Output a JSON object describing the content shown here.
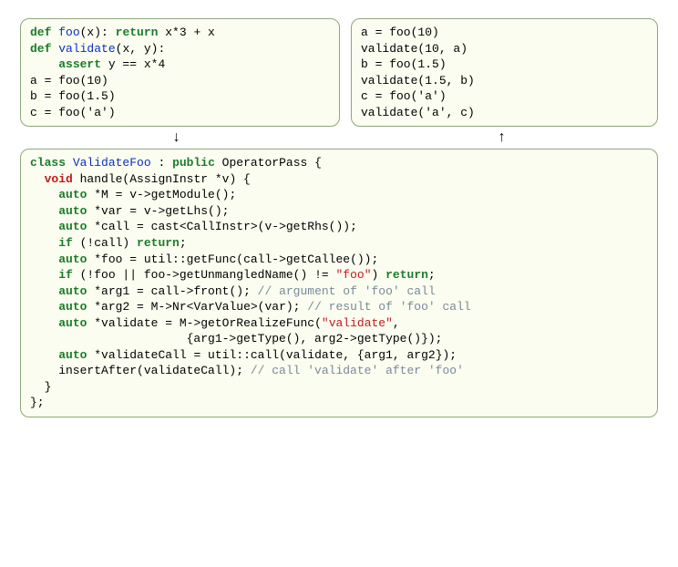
{
  "topLeft": {
    "l1": {
      "def": "def",
      "foo": "foo",
      "rest": "(x): ",
      "ret": "return",
      "expr": " x*3 + x"
    },
    "l2": {
      "def": "def",
      "val": "validate",
      "rest": "(x, y):"
    },
    "l3": {
      "assert": "assert",
      "expr": " y == x*4"
    },
    "l4": "a = foo(10)",
    "l5": "b = foo(1.5)",
    "l6": "c = foo('a')"
  },
  "topRight": {
    "l1": "a = foo(10)",
    "l2": "validate(10, a)",
    "l3": "b = foo(1.5)",
    "l4": "validate(1.5, b)",
    "l5": "c = foo('a')",
    "l6": "validate('a', c)"
  },
  "arrows": {
    "down": "↓",
    "up": "↑"
  },
  "main": {
    "l1": {
      "cls": "class",
      "name": "ValidateFoo",
      "colon": " : ",
      "pub": "public",
      "rest": " OperatorPass {"
    },
    "l2": {
      "void": "void",
      "rest": " handle(AssignInstr *v) {"
    },
    "l3": {
      "auto": "auto",
      "rest": " *M = v->getModule();"
    },
    "l4": {
      "auto": "auto",
      "rest": " *var = v->getLhs();"
    },
    "l5": {
      "auto": "auto",
      "rest": " *call = cast<CallInstr>(v->getRhs());"
    },
    "l6": {
      "if": "if",
      "mid": " (!call) ",
      "ret": "return",
      "semi": ";"
    },
    "l7": {
      "auto": "auto",
      "rest": " *foo = util::getFunc(call->getCallee());"
    },
    "l8": {
      "if": "if",
      "mid": " (!foo || foo->getUnmangledName() != ",
      "str": "\"foo\"",
      "paren": ") ",
      "ret": "return",
      "semi": ";"
    },
    "l9": {
      "auto": "auto",
      "rest": " *arg1 = call->front(); ",
      "cm": "// argument of 'foo' call"
    },
    "l10": {
      "auto": "auto",
      "rest": " *arg2 = M->Nr<VarValue>(var); ",
      "cm": "// result of 'foo' call"
    },
    "l11": {
      "auto": "auto",
      "rest": " *validate = M->getOrRealizeFunc(",
      "str": "\"validate\"",
      "tail": ","
    },
    "l12": "                      {arg1->getType(), arg2->getType()});",
    "l13": {
      "auto": "auto",
      "rest": " *validateCall = util::call(validate, {arg1, arg2});"
    },
    "l14": {
      "head": "    insertAfter(validateCall); ",
      "cm": "// call 'validate' after 'foo'"
    },
    "l15": "  }",
    "l16": "};"
  }
}
